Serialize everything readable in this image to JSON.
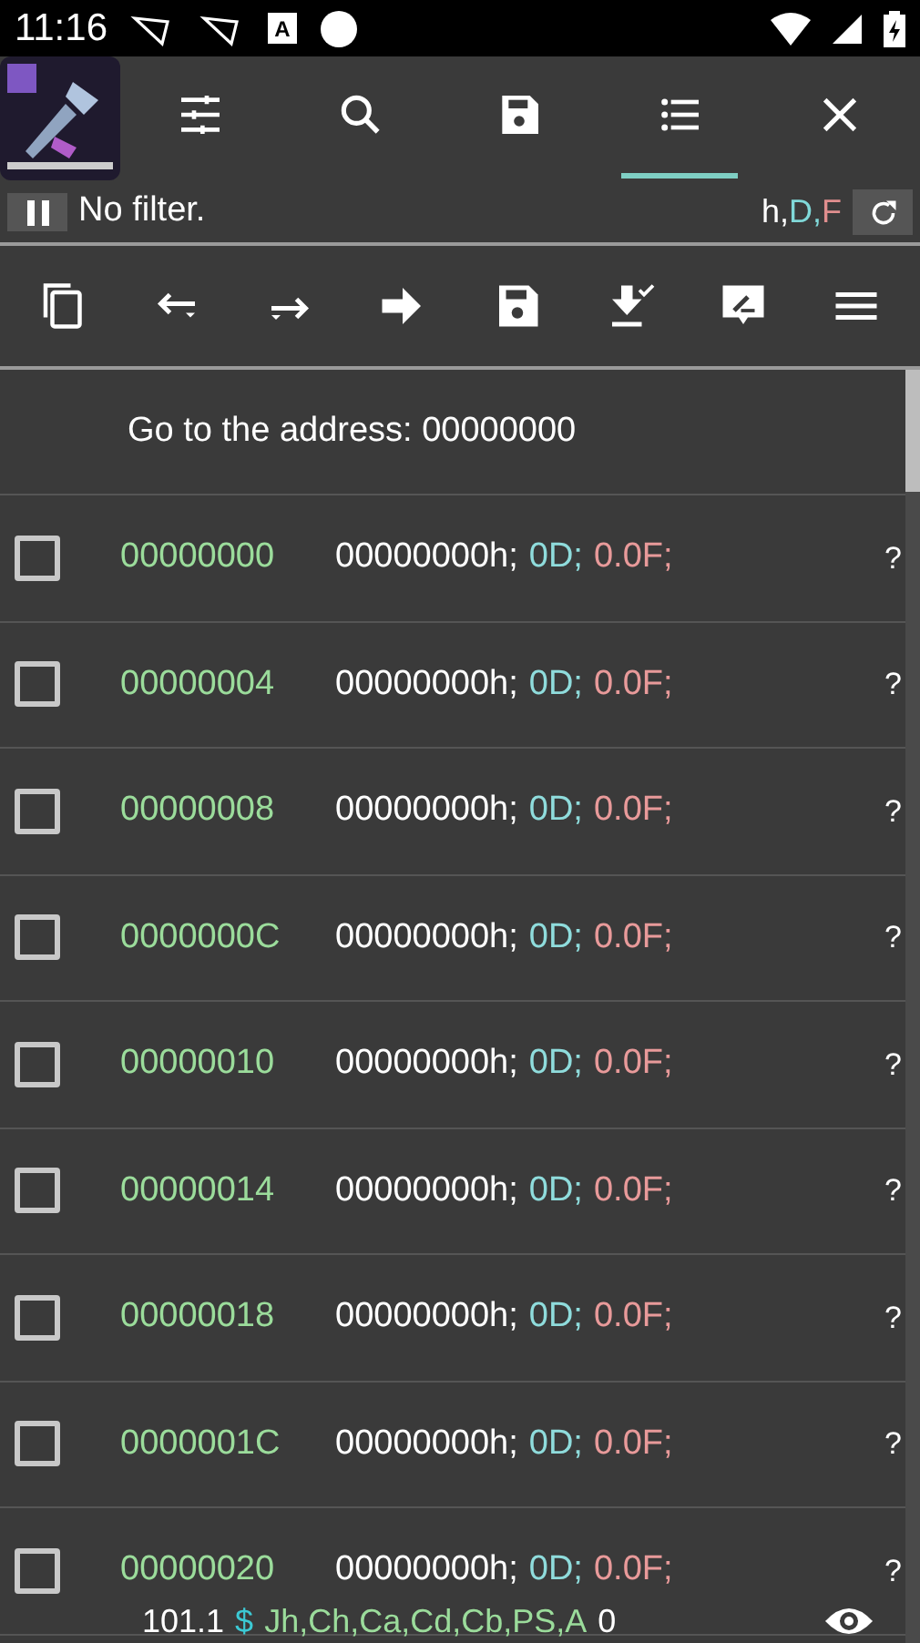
{
  "status_bar": {
    "time": "11:16",
    "badge_letter": "A"
  },
  "tabs": [
    {
      "kind": "settings",
      "selected": false
    },
    {
      "kind": "search",
      "selected": false
    },
    {
      "kind": "save",
      "selected": false
    },
    {
      "kind": "list",
      "selected": true
    },
    {
      "kind": "close",
      "selected": false
    }
  ],
  "filter_bar": {
    "paused": true,
    "text": "No filter.",
    "types": [
      {
        "text": "h,",
        "color": "#ffffff"
      },
      {
        "text": "D,",
        "color": "#80d8d8"
      },
      {
        "text": "F",
        "color": "#e08e8e"
      }
    ]
  },
  "actions": [
    {
      "kind": "copy"
    },
    {
      "kind": "back"
    },
    {
      "kind": "forward"
    },
    {
      "kind": "goto"
    },
    {
      "kind": "save"
    },
    {
      "kind": "load"
    },
    {
      "kind": "edit"
    },
    {
      "kind": "menu"
    }
  ],
  "goto_row": {
    "text": "Go to the address: 00000000"
  },
  "rows": [
    {
      "address": "00000000",
      "hex": "00000000h;",
      "dword": "0D;",
      "float": "0.0F;",
      "extra": "?",
      "checked": false
    },
    {
      "address": "00000004",
      "hex": "00000000h;",
      "dword": "0D;",
      "float": "0.0F;",
      "extra": "?",
      "checked": false
    },
    {
      "address": "00000008",
      "hex": "00000000h;",
      "dword": "0D;",
      "float": "0.0F;",
      "extra": "?",
      "checked": false
    },
    {
      "address": "0000000C",
      "hex": "00000000h;",
      "dword": "0D;",
      "float": "0.0F;",
      "extra": "?",
      "checked": false
    },
    {
      "address": "00000010",
      "hex": "00000000h;",
      "dword": "0D;",
      "float": "0.0F;",
      "extra": "?",
      "checked": false
    },
    {
      "address": "00000014",
      "hex": "00000000h;",
      "dword": "0D;",
      "float": "0.0F;",
      "extra": "?",
      "checked": false
    },
    {
      "address": "00000018",
      "hex": "00000000h;",
      "dword": "0D;",
      "float": "0.0F;",
      "extra": "?",
      "checked": false
    },
    {
      "address": "0000001C",
      "hex": "00000000h;",
      "dword": "0D;",
      "float": "0.0F;",
      "extra": "?",
      "checked": false
    },
    {
      "address": "00000020",
      "hex": "00000000h;",
      "dword": "0D;",
      "float": "0.0F;",
      "extra": "?",
      "checked": false
    }
  ],
  "footer": {
    "version": "101.1",
    "symbol": "$",
    "regions": "Jh,Ch,Ca,Cd,Cb,PS,A",
    "count": "0"
  }
}
